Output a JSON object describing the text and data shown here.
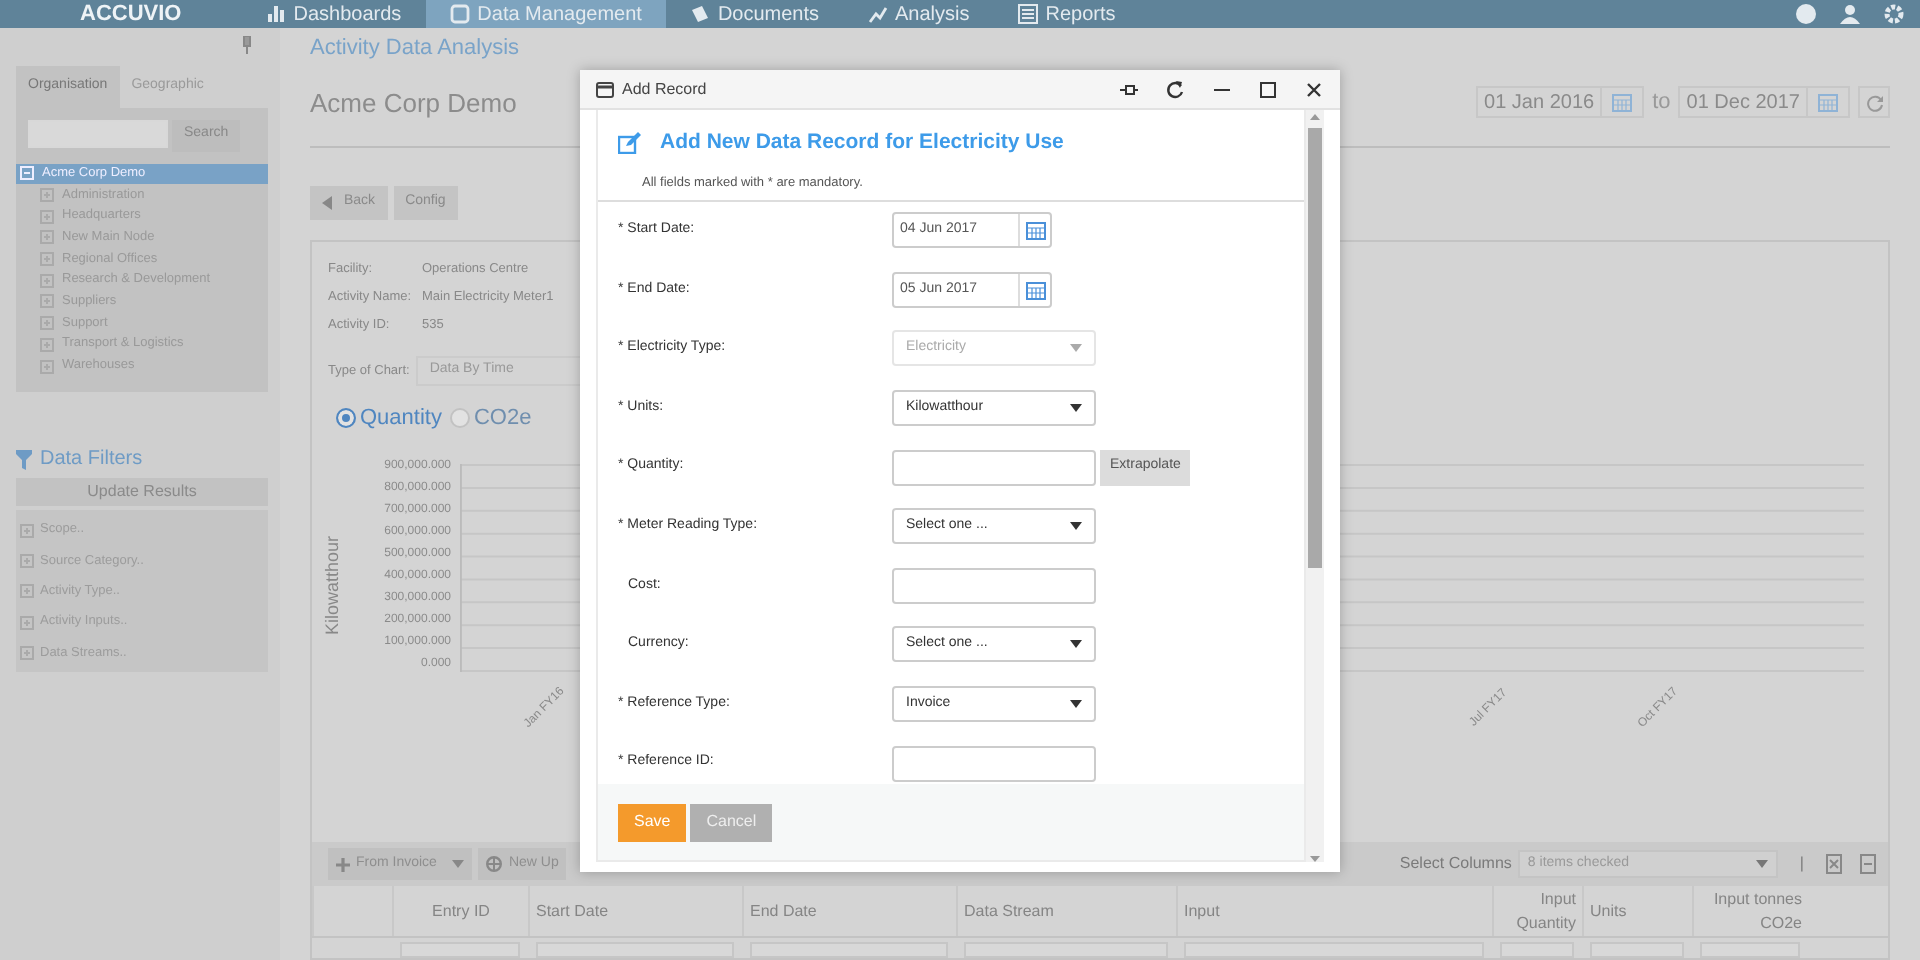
{
  "nav": {
    "logo": "ACCUVIO",
    "items": [
      {
        "label": "Dashboards",
        "kind": "bars",
        "selected": false
      },
      {
        "label": "Data Management",
        "kind": "box",
        "selected": true
      },
      {
        "label": "Documents",
        "kind": "docs",
        "selected": false
      },
      {
        "label": "Analysis",
        "kind": "trend",
        "selected": false
      },
      {
        "label": "Reports",
        "kind": "list",
        "selected": false
      }
    ]
  },
  "sidebar": {
    "tabs": [
      {
        "label": "Organisation",
        "selected": true
      },
      {
        "label": "Geographic",
        "selected": false
      }
    ],
    "search_button": "Search",
    "tree": [
      {
        "label": "Acme Corp Demo",
        "selected": true,
        "expanded": true,
        "children": [
          {
            "label": "Administration",
            "selected": false,
            "expanded": false
          },
          {
            "label": "Headquarters",
            "selected": false,
            "expanded": false
          },
          {
            "label": "New Main Node",
            "selected": false,
            "expanded": false
          },
          {
            "label": "Regional Offices",
            "selected": false,
            "expanded": false
          },
          {
            "label": "Research & Development",
            "selected": false,
            "expanded": false
          },
          {
            "label": "Suppliers",
            "selected": false,
            "expanded": false
          },
          {
            "label": "Support",
            "selected": false,
            "expanded": false
          },
          {
            "label": "Transport & Logistics",
            "selected": false,
            "expanded": false
          },
          {
            "label": "Warehouses",
            "selected": false,
            "expanded": false
          }
        ]
      }
    ],
    "filters": {
      "title": "Data Filters",
      "update_button": "Update Results",
      "items": [
        "Scope..",
        "Source Category..",
        "Activity Type..",
        "Activity Inputs..",
        "Data Streams.."
      ]
    }
  },
  "page": {
    "breadcrumb": "Activity Data Analysis",
    "title": "Acme Corp Demo",
    "date_from": "01 Jan 2016",
    "date_sep": "to",
    "date_to": "01 Dec 2017",
    "buttons": [
      {
        "label": "Back",
        "kind": "back"
      },
      {
        "label": "Config",
        "kind": "plain"
      }
    ]
  },
  "details": [
    {
      "label": "Facility:",
      "value": "Operations Centre"
    },
    {
      "label": "Activity Name:",
      "value": "Main Electricity Meter1"
    },
    {
      "label": "Activity ID:",
      "value": "535"
    }
  ],
  "chart_type": {
    "label": "Type of Chart:",
    "value": "Data By Time"
  },
  "measures": [
    {
      "label": "Quantity",
      "selected": true
    },
    {
      "label": "CO2e",
      "selected": false
    }
  ],
  "chart": {
    "ylabel": "Kilowatthour",
    "yticks": [
      "900,000.000",
      "800,000.000",
      "700,000.000",
      "600,000.000",
      "500,000.000",
      "400,000.000",
      "300,000.000",
      "200,000.000",
      "100,000.000",
      "0.000"
    ],
    "xlabels": [
      "Jan FY16",
      "Jul FY17",
      "Oct FY17"
    ]
  },
  "table": {
    "toolbar": {
      "from_invoice": "From Invoice",
      "new_upload": "New Up",
      "select_columns_label": "Select Columns",
      "select_columns_value": "8 items checked",
      "separator": "|"
    },
    "columns": [
      "Entry ID",
      "Start Date",
      "End Date",
      "Data Stream",
      "Input",
      "Input Quantity",
      "Units",
      "Input tonnes CO2e"
    ]
  },
  "modal": {
    "title": "Add Record",
    "heading": "Add New Data Record for Electricity Use",
    "note": "All fields marked with * are mandatory.",
    "fields": [
      {
        "kind": "date",
        "label": "* Start Date:",
        "required": true,
        "value": "04 Jun 2017"
      },
      {
        "kind": "date",
        "label": "* End Date:",
        "required": true,
        "value": "05 Jun 2017"
      },
      {
        "kind": "select",
        "label": "* Electricity Type:",
        "required": true,
        "value": "Electricity",
        "disabled": true
      },
      {
        "kind": "select",
        "label": "* Units:",
        "required": true,
        "value": "Kilowatthour",
        "disabled": false
      },
      {
        "kind": "input",
        "label": "* Quantity:",
        "required": true,
        "action": "Extrapolate"
      },
      {
        "kind": "select",
        "label": "* Meter Reading Type:",
        "required": true,
        "value": "Select one ...",
        "disabled": false
      },
      {
        "kind": "input",
        "label": "Cost:",
        "required": false
      },
      {
        "kind": "select",
        "label": "Currency:",
        "required": false,
        "value": "Select one ...",
        "disabled": false
      },
      {
        "kind": "select",
        "label": "* Reference Type:",
        "required": true,
        "value": "Invoice",
        "disabled": false
      },
      {
        "kind": "input",
        "label": "* Reference ID:",
        "required": true
      }
    ],
    "buttons": [
      {
        "label": "Save",
        "kind": "primary"
      },
      {
        "label": "Cancel",
        "kind": "secondary"
      }
    ]
  }
}
